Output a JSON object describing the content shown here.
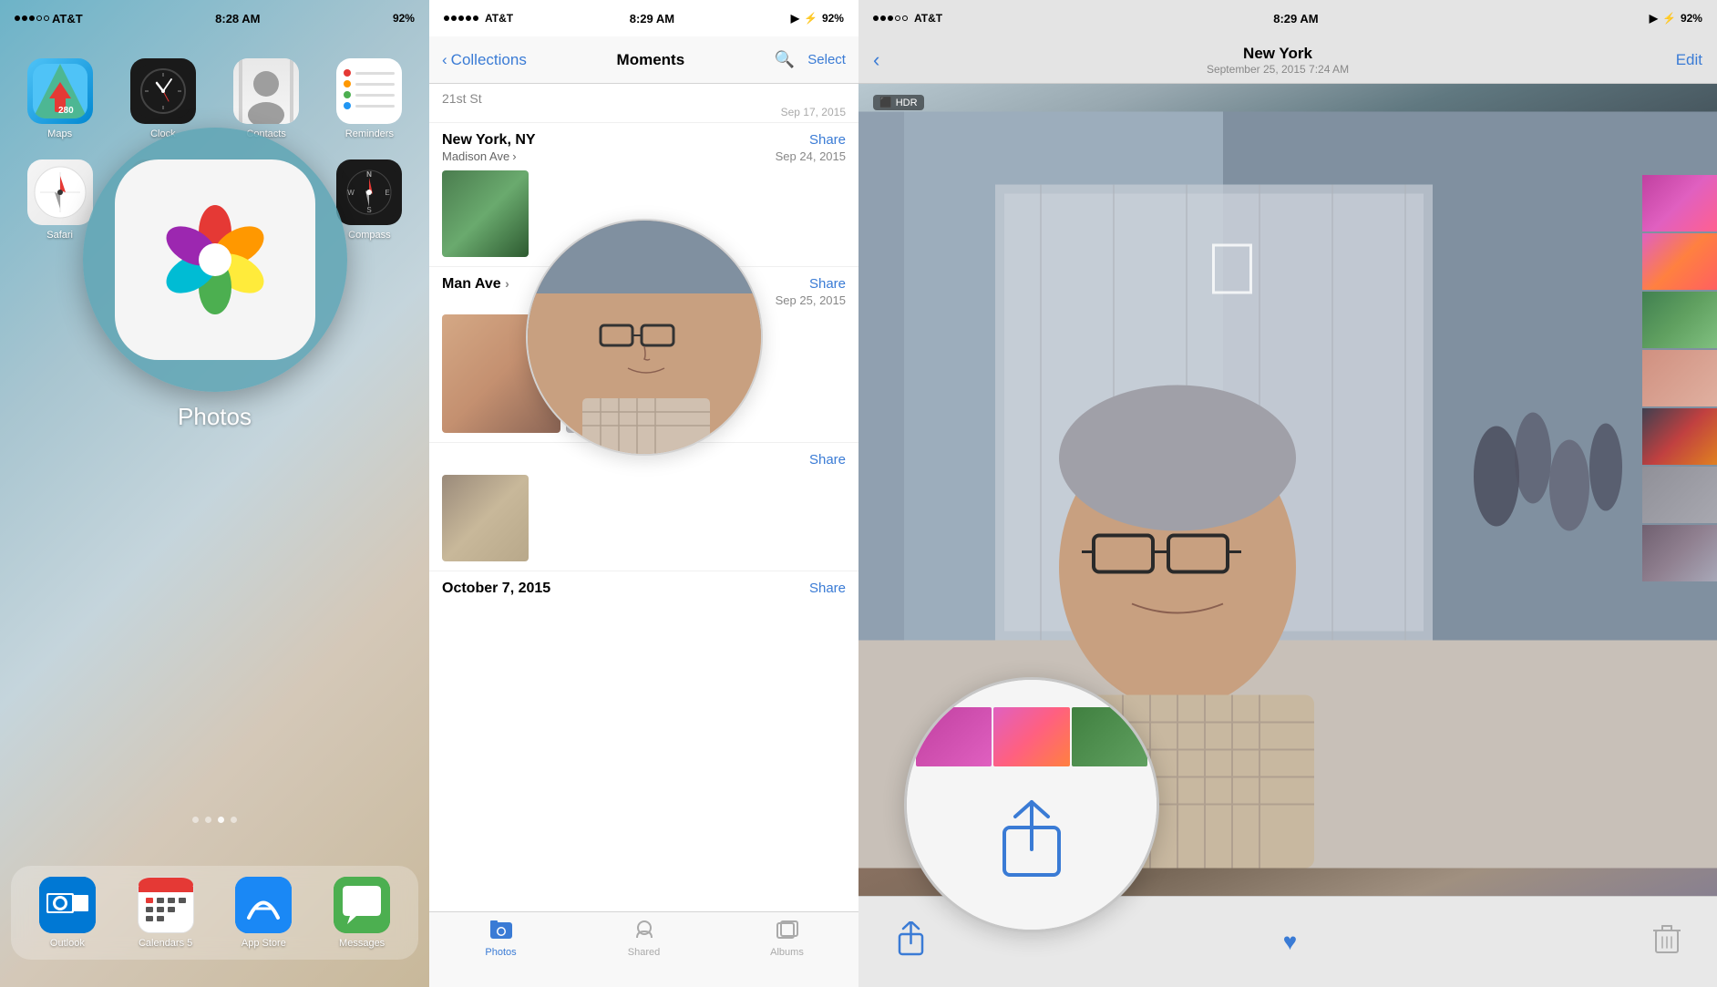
{
  "panel1": {
    "status": {
      "carrier": "AT&T",
      "time": "8:28 AM",
      "battery": "92%"
    },
    "apps": [
      {
        "id": "maps",
        "label": "Maps"
      },
      {
        "id": "clock",
        "label": "Clock"
      },
      {
        "id": "contacts",
        "label": "Contacts"
      },
      {
        "id": "reminders",
        "label": "Reminders"
      },
      {
        "id": "safari",
        "label": "Safari"
      },
      {
        "id": "settings",
        "label": ""
      },
      {
        "id": "photos-zoom",
        "label": ""
      },
      {
        "id": "compass",
        "label": "Compass"
      }
    ],
    "zoom_label": "Photos",
    "dock": [
      {
        "id": "outlook",
        "label": "Outlook"
      },
      {
        "id": "calendars",
        "label": "Calendars 5"
      },
      {
        "id": "appstore",
        "label": "App Store"
      },
      {
        "id": "messages",
        "label": "Messages"
      }
    ]
  },
  "panel2": {
    "status": {
      "carrier": "AT&T",
      "time": "8:29 AM",
      "battery": "92%"
    },
    "nav": {
      "back_label": "Collections",
      "title": "Moments",
      "select_label": "Select"
    },
    "moments": [
      {
        "location": "New York, NY",
        "sublocation": "Madison Ave",
        "share": "Share",
        "date": "Sep 24, 2015"
      },
      {
        "location": "Man Ave",
        "sublocation": "",
        "share": "Share",
        "date": "Sep 25, 2015"
      },
      {
        "location": "",
        "share": "Share",
        "date": ""
      },
      {
        "location": "October 7, 2015",
        "share": "Share",
        "date": ""
      }
    ],
    "tabs": [
      {
        "id": "photos",
        "label": "Photos",
        "active": true
      },
      {
        "id": "shared",
        "label": "Shared",
        "active": false
      },
      {
        "id": "albums",
        "label": "Albums",
        "active": false
      }
    ]
  },
  "panel3": {
    "status": {
      "carrier": "AT&T",
      "time": "8:29 AM",
      "battery": "92%"
    },
    "nav": {
      "back_label": "",
      "title": "New York",
      "subtitle": "September 25, 2015  7:24 AM",
      "edit_label": "Edit"
    },
    "hdr_label": "HDR",
    "actions": {
      "share": "",
      "heart": "♥",
      "trash": "🗑"
    }
  }
}
